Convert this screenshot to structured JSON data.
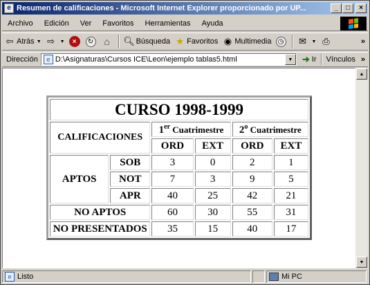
{
  "window": {
    "title": "Resumen de calificaciones - Microsoft Internet Explorer proporcionado por UP...",
    "controls": [
      "_",
      "□",
      "×"
    ]
  },
  "menu": [
    "Archivo",
    "Edición",
    "Ver",
    "Favoritos",
    "Herramientas",
    "Ayuda"
  ],
  "toolbar": {
    "back": "Atrás",
    "search": "Búsqueda",
    "favorites": "Favoritos",
    "media": "Multimedia",
    "more": "»"
  },
  "address": {
    "label": "Dirección",
    "value": "D:\\Asignaturas\\Cursos ICE\\Leon\\ejemplo tablas5.html",
    "go": "Ir",
    "links": "Vínculos",
    "more": "»"
  },
  "table": {
    "title": "CURSO 1998-1999",
    "calificaciones": "CALIFICACIONES",
    "q1": {
      "prefix": "1",
      "sup": "er",
      "rest": " Cuatrimestre"
    },
    "q2": {
      "prefix": "2",
      "sup": "o",
      "rest": " Cuatrimestre"
    },
    "ord": "ORD",
    "ext": "EXT",
    "aptos": "APTOS",
    "rows": [
      {
        "label": "SOB",
        "values": [
          "3",
          "0",
          "2",
          "1"
        ]
      },
      {
        "label": "NOT",
        "values": [
          "7",
          "3",
          "9",
          "5"
        ]
      },
      {
        "label": "APR",
        "values": [
          "40",
          "25",
          "42",
          "21"
        ]
      }
    ],
    "no_aptos": {
      "label": "NO APTOS",
      "values": [
        "60",
        "30",
        "55",
        "31"
      ]
    },
    "no_presentados": {
      "label": "NO PRESENTADOS",
      "values": [
        "35",
        "15",
        "40",
        "17"
      ]
    }
  },
  "status": {
    "text": "Listo",
    "zone": "Mi PC"
  }
}
